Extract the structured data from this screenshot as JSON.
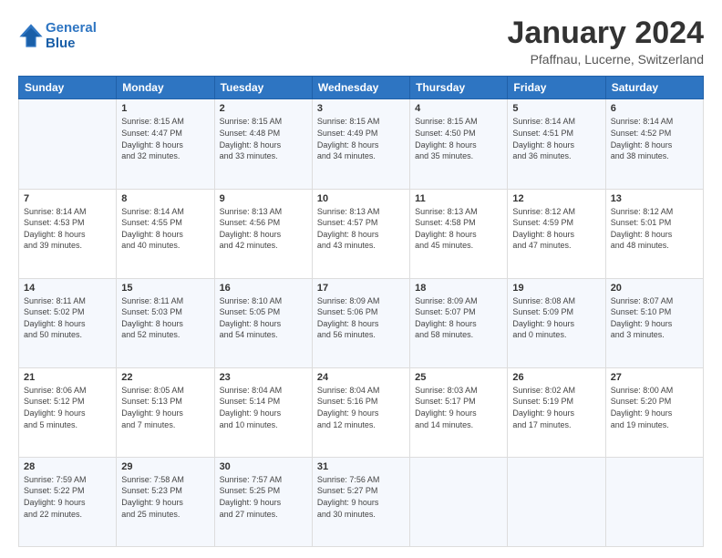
{
  "header": {
    "logo_line1": "General",
    "logo_line2": "Blue",
    "month": "January 2024",
    "location": "Pfaffnau, Lucerne, Switzerland"
  },
  "days_of_week": [
    "Sunday",
    "Monday",
    "Tuesday",
    "Wednesday",
    "Thursday",
    "Friday",
    "Saturday"
  ],
  "weeks": [
    [
      {
        "day": "",
        "info": ""
      },
      {
        "day": "1",
        "info": "Sunrise: 8:15 AM\nSunset: 4:47 PM\nDaylight: 8 hours\nand 32 minutes."
      },
      {
        "day": "2",
        "info": "Sunrise: 8:15 AM\nSunset: 4:48 PM\nDaylight: 8 hours\nand 33 minutes."
      },
      {
        "day": "3",
        "info": "Sunrise: 8:15 AM\nSunset: 4:49 PM\nDaylight: 8 hours\nand 34 minutes."
      },
      {
        "day": "4",
        "info": "Sunrise: 8:15 AM\nSunset: 4:50 PM\nDaylight: 8 hours\nand 35 minutes."
      },
      {
        "day": "5",
        "info": "Sunrise: 8:14 AM\nSunset: 4:51 PM\nDaylight: 8 hours\nand 36 minutes."
      },
      {
        "day": "6",
        "info": "Sunrise: 8:14 AM\nSunset: 4:52 PM\nDaylight: 8 hours\nand 38 minutes."
      }
    ],
    [
      {
        "day": "7",
        "info": "Sunrise: 8:14 AM\nSunset: 4:53 PM\nDaylight: 8 hours\nand 39 minutes."
      },
      {
        "day": "8",
        "info": "Sunrise: 8:14 AM\nSunset: 4:55 PM\nDaylight: 8 hours\nand 40 minutes."
      },
      {
        "day": "9",
        "info": "Sunrise: 8:13 AM\nSunset: 4:56 PM\nDaylight: 8 hours\nand 42 minutes."
      },
      {
        "day": "10",
        "info": "Sunrise: 8:13 AM\nSunset: 4:57 PM\nDaylight: 8 hours\nand 43 minutes."
      },
      {
        "day": "11",
        "info": "Sunrise: 8:13 AM\nSunset: 4:58 PM\nDaylight: 8 hours\nand 45 minutes."
      },
      {
        "day": "12",
        "info": "Sunrise: 8:12 AM\nSunset: 4:59 PM\nDaylight: 8 hours\nand 47 minutes."
      },
      {
        "day": "13",
        "info": "Sunrise: 8:12 AM\nSunset: 5:01 PM\nDaylight: 8 hours\nand 48 minutes."
      }
    ],
    [
      {
        "day": "14",
        "info": "Sunrise: 8:11 AM\nSunset: 5:02 PM\nDaylight: 8 hours\nand 50 minutes."
      },
      {
        "day": "15",
        "info": "Sunrise: 8:11 AM\nSunset: 5:03 PM\nDaylight: 8 hours\nand 52 minutes."
      },
      {
        "day": "16",
        "info": "Sunrise: 8:10 AM\nSunset: 5:05 PM\nDaylight: 8 hours\nand 54 minutes."
      },
      {
        "day": "17",
        "info": "Sunrise: 8:09 AM\nSunset: 5:06 PM\nDaylight: 8 hours\nand 56 minutes."
      },
      {
        "day": "18",
        "info": "Sunrise: 8:09 AM\nSunset: 5:07 PM\nDaylight: 8 hours\nand 58 minutes."
      },
      {
        "day": "19",
        "info": "Sunrise: 8:08 AM\nSunset: 5:09 PM\nDaylight: 9 hours\nand 0 minutes."
      },
      {
        "day": "20",
        "info": "Sunrise: 8:07 AM\nSunset: 5:10 PM\nDaylight: 9 hours\nand 3 minutes."
      }
    ],
    [
      {
        "day": "21",
        "info": "Sunrise: 8:06 AM\nSunset: 5:12 PM\nDaylight: 9 hours\nand 5 minutes."
      },
      {
        "day": "22",
        "info": "Sunrise: 8:05 AM\nSunset: 5:13 PM\nDaylight: 9 hours\nand 7 minutes."
      },
      {
        "day": "23",
        "info": "Sunrise: 8:04 AM\nSunset: 5:14 PM\nDaylight: 9 hours\nand 10 minutes."
      },
      {
        "day": "24",
        "info": "Sunrise: 8:04 AM\nSunset: 5:16 PM\nDaylight: 9 hours\nand 12 minutes."
      },
      {
        "day": "25",
        "info": "Sunrise: 8:03 AM\nSunset: 5:17 PM\nDaylight: 9 hours\nand 14 minutes."
      },
      {
        "day": "26",
        "info": "Sunrise: 8:02 AM\nSunset: 5:19 PM\nDaylight: 9 hours\nand 17 minutes."
      },
      {
        "day": "27",
        "info": "Sunrise: 8:00 AM\nSunset: 5:20 PM\nDaylight: 9 hours\nand 19 minutes."
      }
    ],
    [
      {
        "day": "28",
        "info": "Sunrise: 7:59 AM\nSunset: 5:22 PM\nDaylight: 9 hours\nand 22 minutes."
      },
      {
        "day": "29",
        "info": "Sunrise: 7:58 AM\nSunset: 5:23 PM\nDaylight: 9 hours\nand 25 minutes."
      },
      {
        "day": "30",
        "info": "Sunrise: 7:57 AM\nSunset: 5:25 PM\nDaylight: 9 hours\nand 27 minutes."
      },
      {
        "day": "31",
        "info": "Sunrise: 7:56 AM\nSunset: 5:27 PM\nDaylight: 9 hours\nand 30 minutes."
      },
      {
        "day": "",
        "info": ""
      },
      {
        "day": "",
        "info": ""
      },
      {
        "day": "",
        "info": ""
      }
    ]
  ]
}
